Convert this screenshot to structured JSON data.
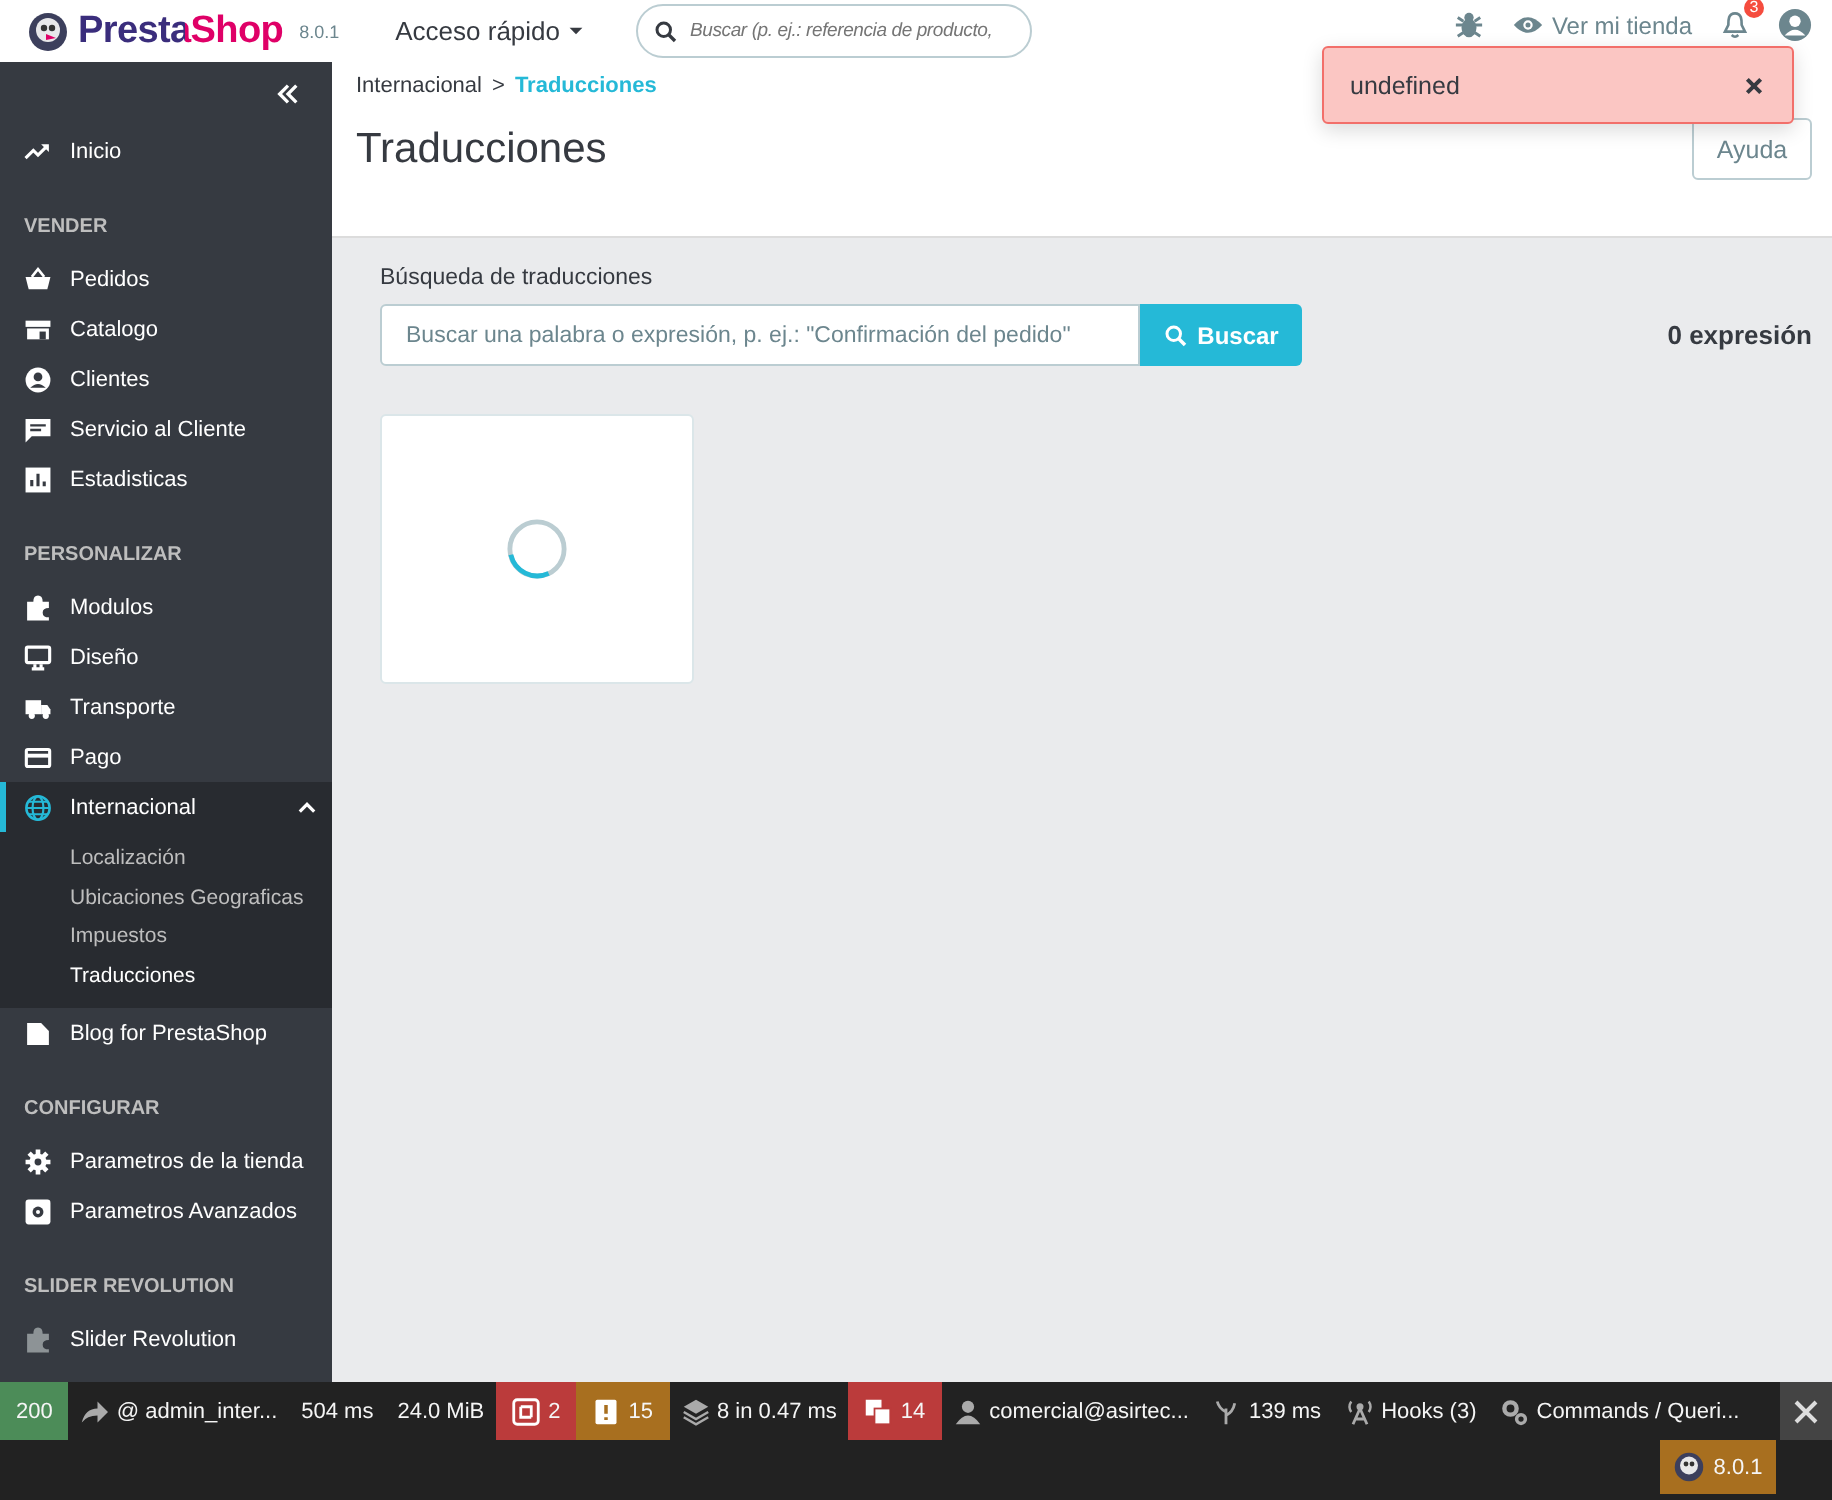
{
  "header": {
    "brand": "PrestaShop",
    "version": "8.0.1",
    "quick_access": "Acceso rápido",
    "search": {
      "placeholder": "Buscar (p. ej.: referencia de producto,"
    },
    "store_link": "Ver mi tienda",
    "notifications": "3"
  },
  "alert": {
    "message": "undefined"
  },
  "sidebar": {
    "items": [
      {
        "kind": "link",
        "label": "Inicio",
        "selected": false
      },
      {
        "kind": "section",
        "label": "VENDER"
      },
      {
        "kind": "link",
        "label": "Pedidos",
        "selected": false
      },
      {
        "kind": "link",
        "label": "Catalogo",
        "selected": false
      },
      {
        "kind": "link",
        "label": "Clientes",
        "selected": false
      },
      {
        "kind": "link",
        "label": "Servicio al Cliente",
        "selected": false
      },
      {
        "kind": "link",
        "label": "Estadisticas",
        "selected": false
      },
      {
        "kind": "section",
        "label": "PERSONALIZAR"
      },
      {
        "kind": "link",
        "label": "Modulos",
        "selected": false
      },
      {
        "kind": "link",
        "label": "Diseño",
        "selected": false
      },
      {
        "kind": "link",
        "label": "Transporte",
        "selected": false
      },
      {
        "kind": "link",
        "label": "Pago",
        "selected": false
      },
      {
        "kind": "link",
        "label": "Internacional",
        "selected": true,
        "expanded": true,
        "children": [
          {
            "label": "Localización",
            "selected": false
          },
          {
            "label": "Ubicaciones Geograficas",
            "selected": false
          },
          {
            "label": "Impuestos",
            "selected": false
          },
          {
            "label": "Traducciones",
            "selected": true
          }
        ]
      },
      {
        "kind": "link",
        "label": "Blog for PrestaShop",
        "selected": false
      },
      {
        "kind": "section",
        "label": "CONFIGURAR"
      },
      {
        "kind": "link",
        "label": "Parametros de la tienda",
        "selected": false
      },
      {
        "kind": "link",
        "label": "Parametros Avanzados",
        "selected": false
      },
      {
        "kind": "section",
        "label": "SLIDER REVOLUTION"
      },
      {
        "kind": "link",
        "label": "Slider Revolution",
        "selected": false
      }
    ]
  },
  "breadcrumb": [
    {
      "label": "Internacional",
      "selected": false
    },
    {
      "label": "Traducciones",
      "selected": true
    }
  ],
  "breadcrumb_separator": ">",
  "page": {
    "title": "Traducciones",
    "help_button": "Ayuda"
  },
  "search": {
    "label": "Búsqueda de traducciones",
    "placeholder": "Buscar una palabra o expresión, p. ej.: \"Confirmación del pedido\"",
    "button": "Buscar",
    "count": "0 expresión"
  },
  "debug_toolbar": {
    "items": [
      {
        "text": "200",
        "color": "#4c8c58"
      },
      {
        "text": "@ admin_inter..."
      },
      {
        "text": "504 ms"
      },
      {
        "text": "24.0 MiB"
      },
      {
        "text": "2",
        "color": "#bb3b3b"
      },
      {
        "text": "15",
        "color": "#a86f1f"
      },
      {
        "text": "8 in 0.47 ms"
      },
      {
        "text": "14",
        "color": "#bb3b3b"
      },
      {
        "text": "comercial@asirtec..."
      },
      {
        "text": "139 ms"
      },
      {
        "text": "Hooks (3)"
      },
      {
        "text": "Commands / Queri..."
      }
    ],
    "version": "8.0.1"
  }
}
